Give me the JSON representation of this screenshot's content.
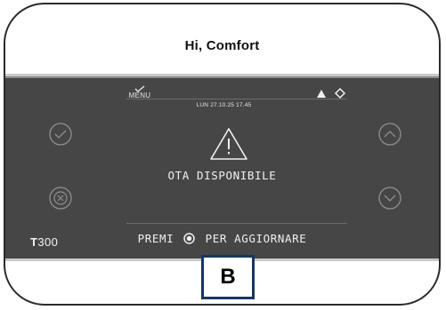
{
  "header": {
    "title": "Hi, Comfort"
  },
  "display": {
    "menu_label": "MENU",
    "datetime": "LUN 27.10.25 17.45",
    "message": "OTA DISPONIBILE",
    "instruction_prefix": "PREMI",
    "instruction_suffix": "PER AGGIORNARE",
    "model_prefix": "T",
    "model_number": "300"
  },
  "icons": {
    "menu": "check-icon",
    "status": [
      "warning-icon",
      "diamond-icon"
    ],
    "message": "warning-triangle-icon",
    "instruction": "button-icon",
    "left_buttons": [
      "confirm-icon",
      "cancel-icon"
    ],
    "right_buttons": [
      "chevron-up-icon",
      "chevron-down-icon"
    ]
  },
  "badge": {
    "label": "B"
  },
  "colors": {
    "screen": "#464646",
    "text": "#f0f0f0",
    "badge_border": "#17365f"
  }
}
